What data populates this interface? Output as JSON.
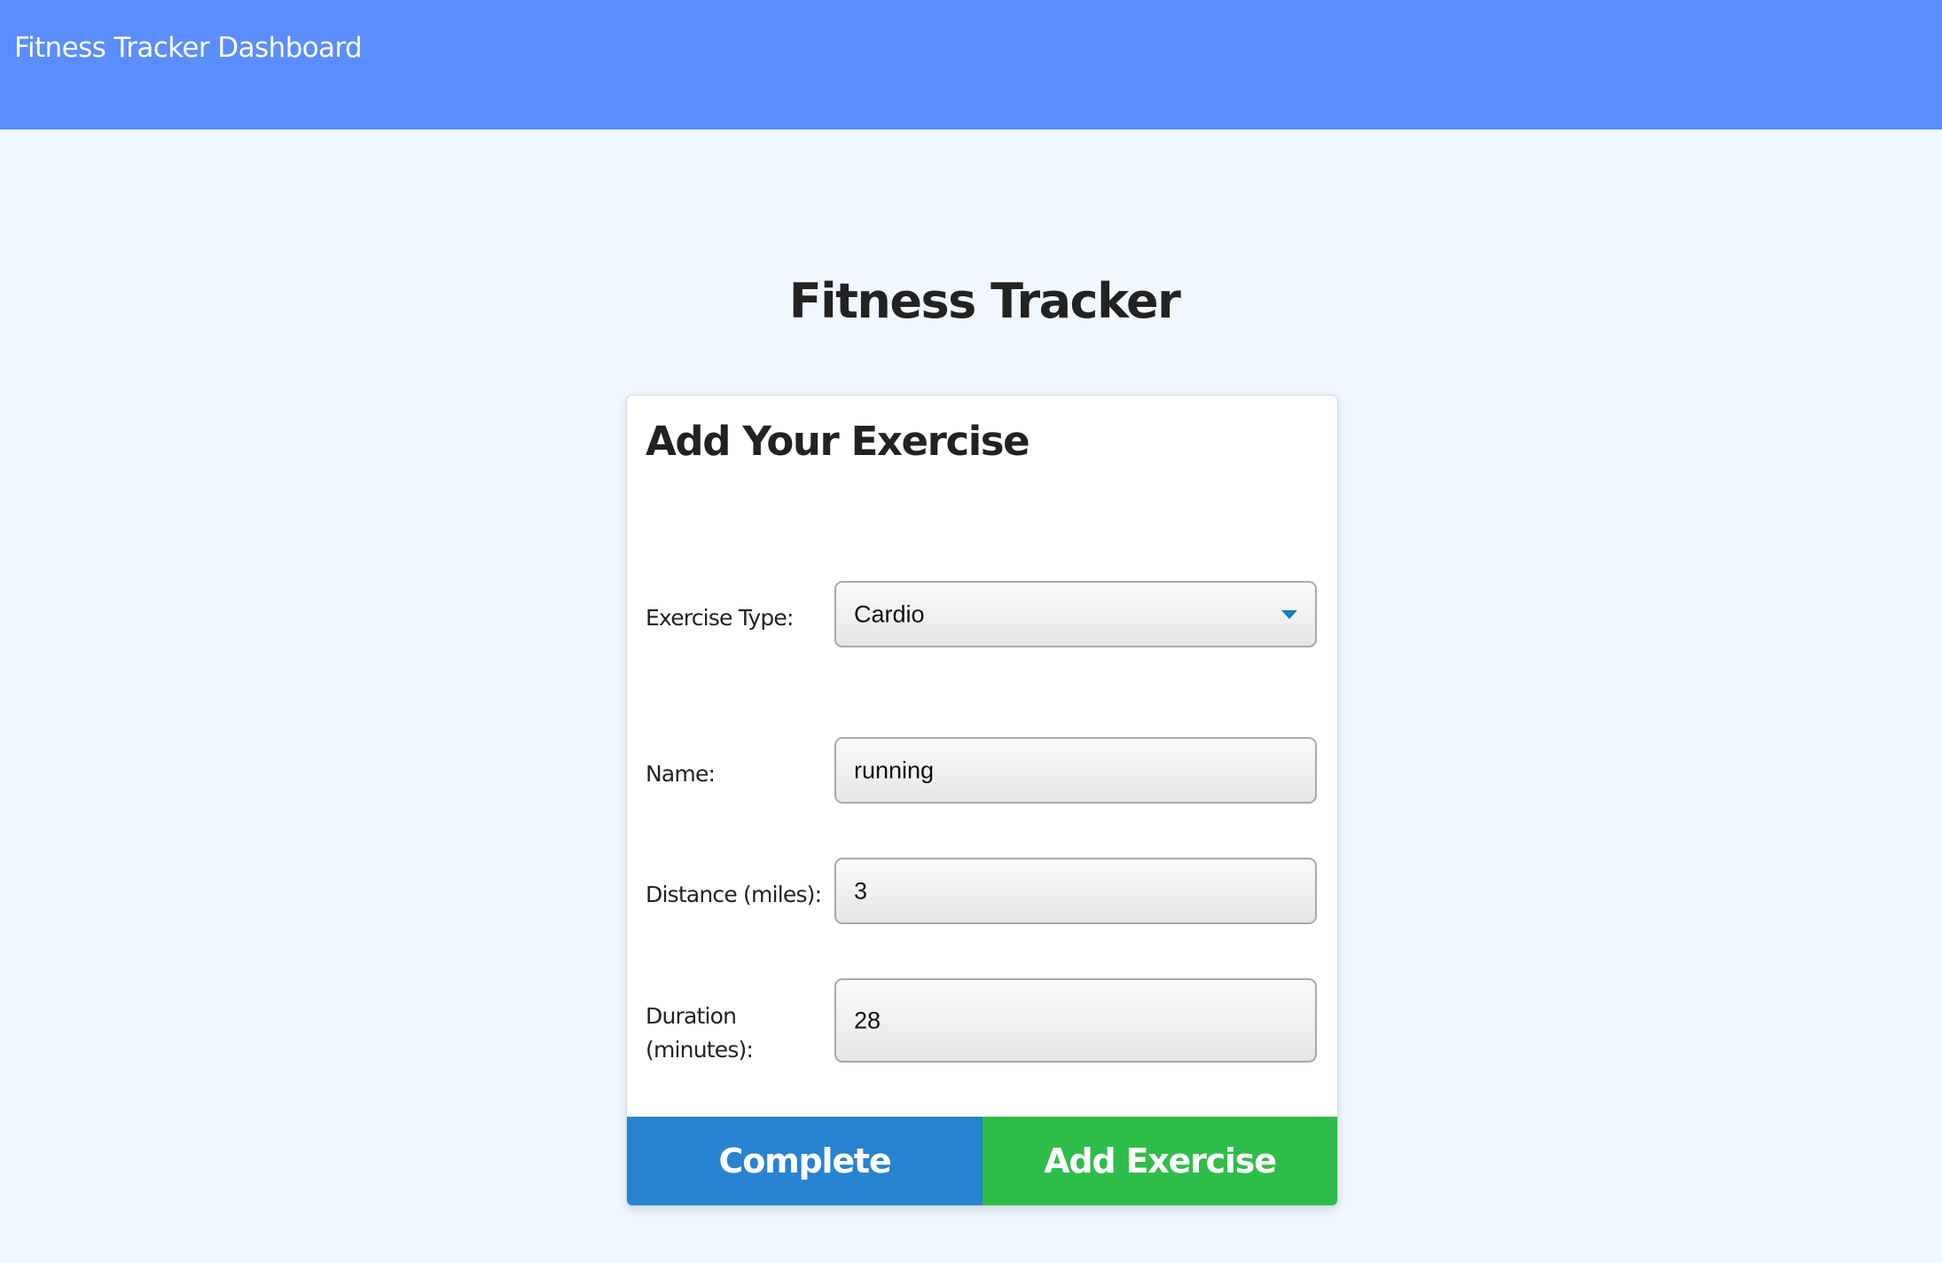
{
  "header": {
    "app_title": "Fitness Tracker Dashboard"
  },
  "main": {
    "title": "Fitness Tracker"
  },
  "form": {
    "title": "Add Your Exercise",
    "fields": {
      "exercise_type": {
        "label": "Exercise Type:",
        "value": "Cardio",
        "icon": "chevron-down-icon"
      },
      "name": {
        "label": "Name:",
        "value": "running"
      },
      "distance": {
        "label": "Distance (miles):",
        "value": "3"
      },
      "duration": {
        "label_line1": "Duration",
        "label_line2": "(minutes):",
        "value": "28"
      }
    },
    "buttons": {
      "complete": "Complete",
      "add_exercise": "Add Exercise"
    }
  },
  "colors": {
    "header_bg": "#5a8dfe",
    "page_bg": "#f0f7ff",
    "complete_button": "#2883d0",
    "add_button": "#2fbd4a",
    "dropdown_arrow": "#1a7fc1"
  }
}
